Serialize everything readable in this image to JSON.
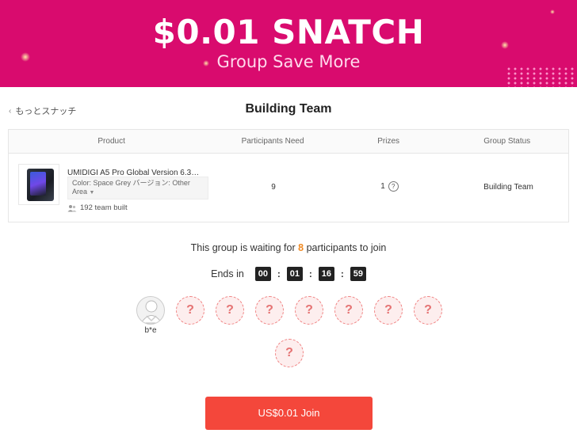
{
  "banner": {
    "title": "$0.01 SNATCH",
    "subtitle": "Group Save More"
  },
  "header": {
    "back_label": "もっとスナッチ",
    "title": "Building Team"
  },
  "table": {
    "headers": [
      "Product",
      "Participants Need",
      "Prizes",
      "Group Status"
    ],
    "row": {
      "product_name": "UMIDIGI A5 Pro Global Version 6.3イン...",
      "variant": "Color: Space Grey バージョン: Other Area",
      "team_built": "192 team built",
      "participants_need": "9",
      "prizes": "1",
      "status": "Building Team"
    }
  },
  "waiting": {
    "prefix": "This group is waiting for",
    "count": "8",
    "suffix": "participants to join"
  },
  "countdown": {
    "label": "Ends in",
    "values": [
      "00",
      "01",
      "16",
      "59"
    ]
  },
  "participants": {
    "host_name": "b*e",
    "empty_slot_glyph": "?"
  },
  "join_button": {
    "label": "US$0.01 Join"
  },
  "colors": {
    "banner": "#d90b6e",
    "accent": "#f4473b",
    "highlight": "#f08a24"
  }
}
